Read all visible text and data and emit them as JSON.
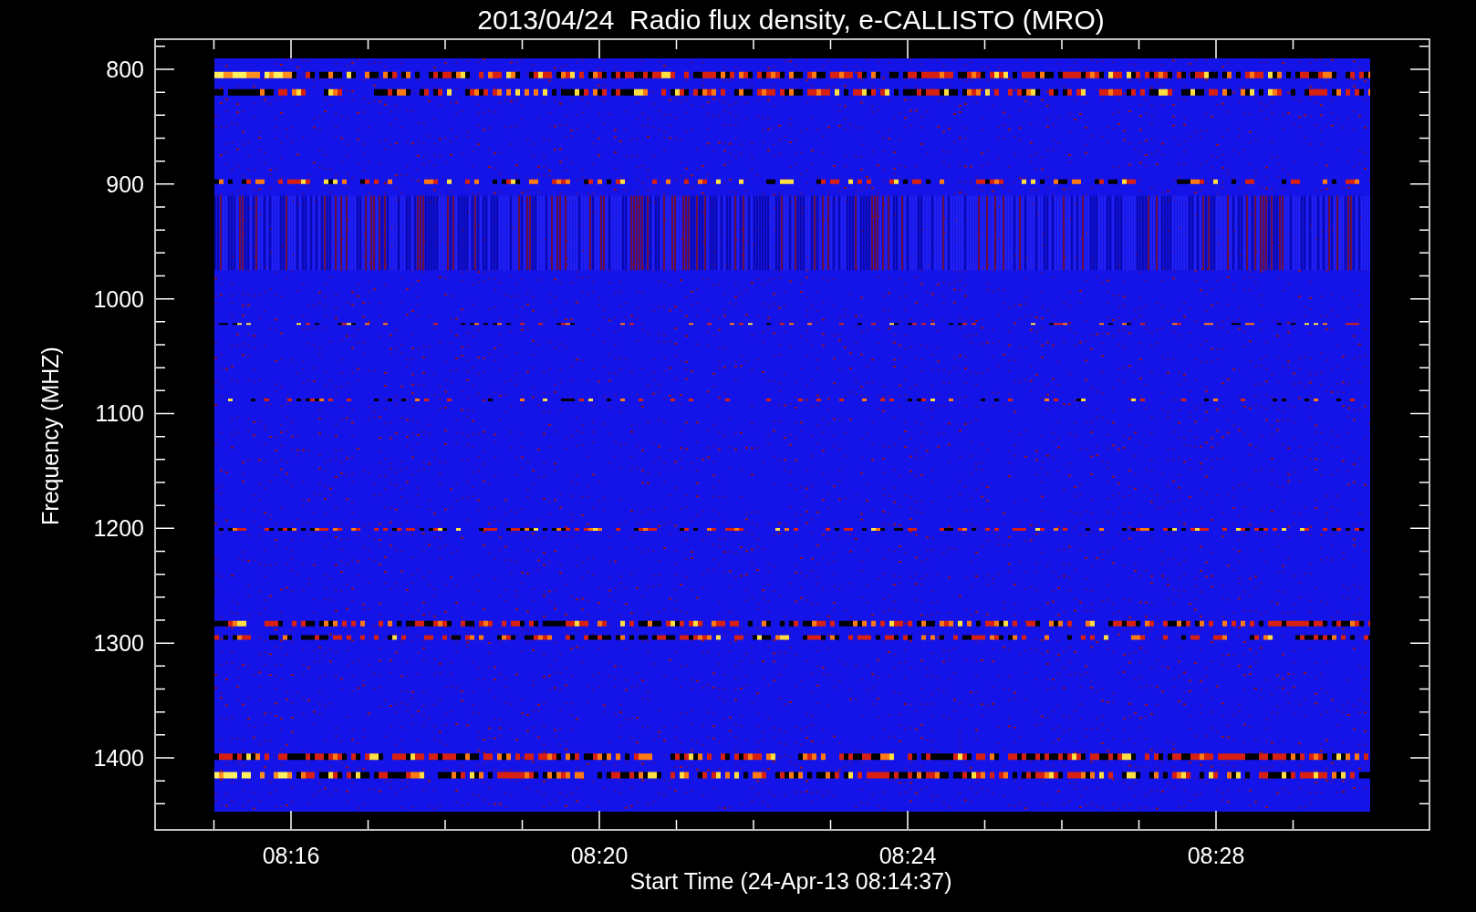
{
  "title": "2013/04/24  Radio flux density, e-CALLISTO (MRO)",
  "y_axis": {
    "label": "Frequency (MHZ)",
    "ticks": [
      "800",
      "900",
      "1000",
      "1100",
      "1200",
      "1300",
      "1400"
    ]
  },
  "x_axis": {
    "label": "Start Time (24-Apr-13 08:14:37)",
    "ticks": [
      "08:16",
      "08:20",
      "08:24",
      "08:28"
    ]
  }
}
